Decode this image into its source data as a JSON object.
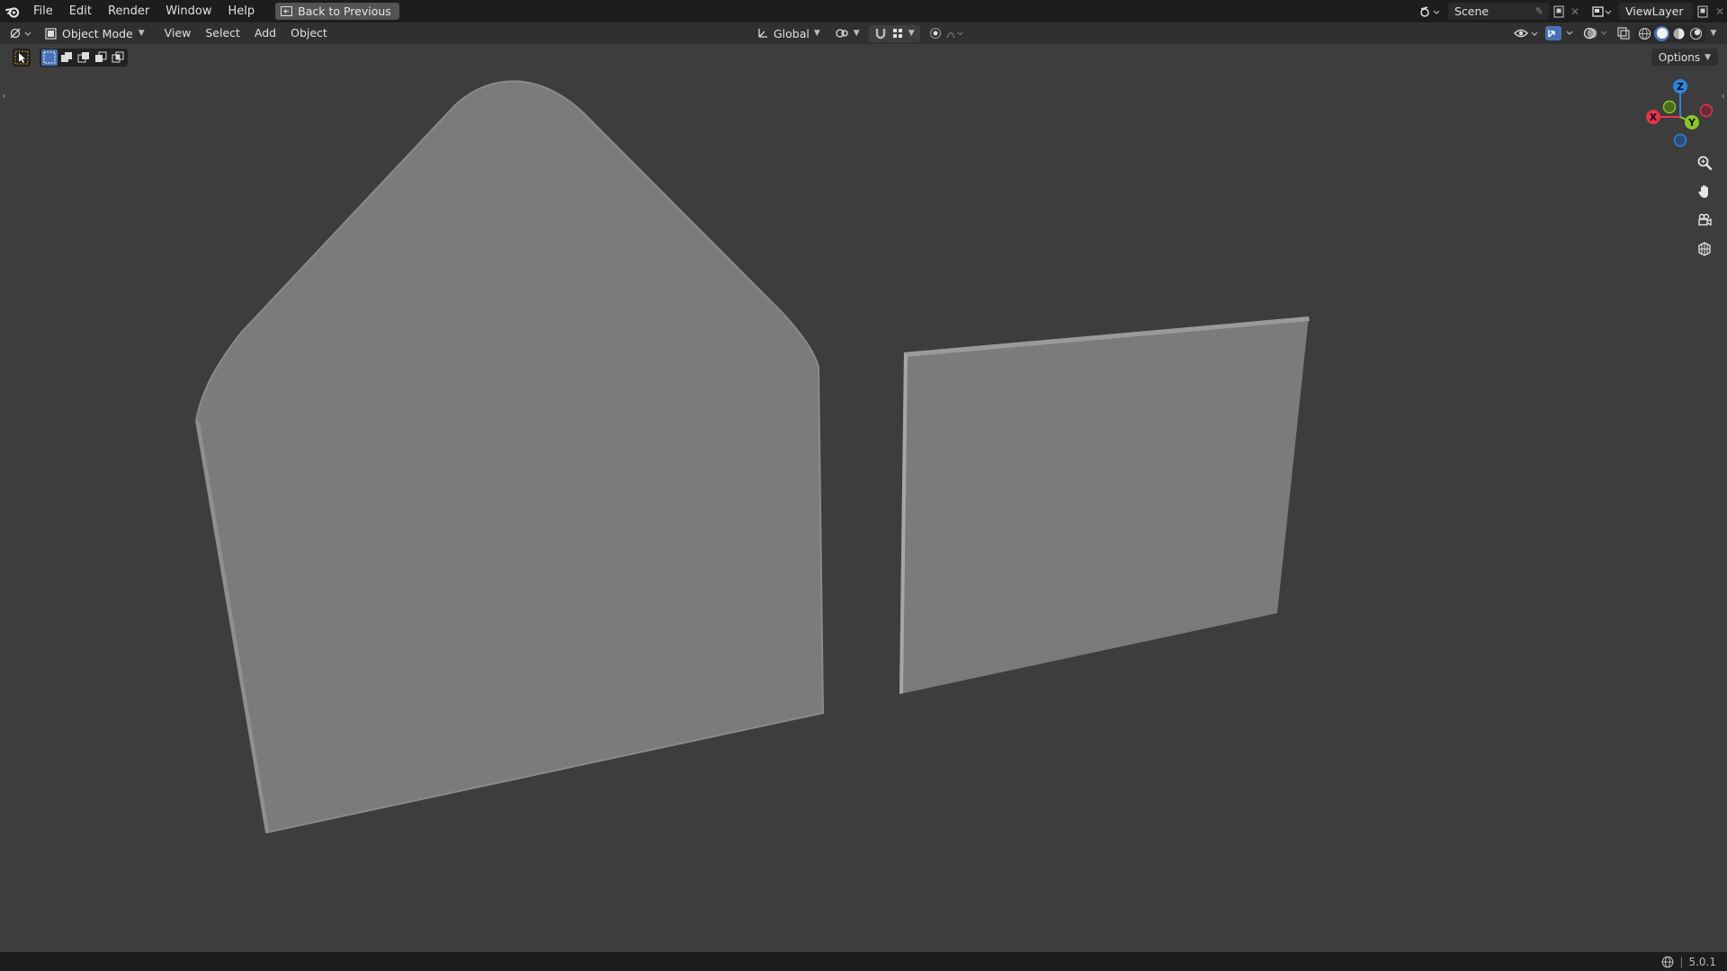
{
  "topbar": {
    "menus": [
      "File",
      "Edit",
      "Render",
      "Window",
      "Help"
    ],
    "back_label": "Back to Previous",
    "scene_name": "Scene",
    "view_layer": "ViewLayer"
  },
  "header": {
    "mode": "Object Mode",
    "menus": [
      "View",
      "Select",
      "Add",
      "Object"
    ],
    "transform_orientation": "Global",
    "options_label": "Options"
  },
  "gizmo": {
    "x_label": "X",
    "y_label": "Y",
    "z_label": "Z",
    "colors": {
      "x": "#e6344e",
      "y": "#8bc824",
      "z": "#2e86de"
    }
  },
  "status": {
    "version": "5.0.1"
  },
  "viewport": {
    "objects": [
      "house-shaped-plane",
      "rectangular-plane"
    ],
    "mesh_color": "#7b7b7b",
    "background_color": "#3d3d3d"
  }
}
